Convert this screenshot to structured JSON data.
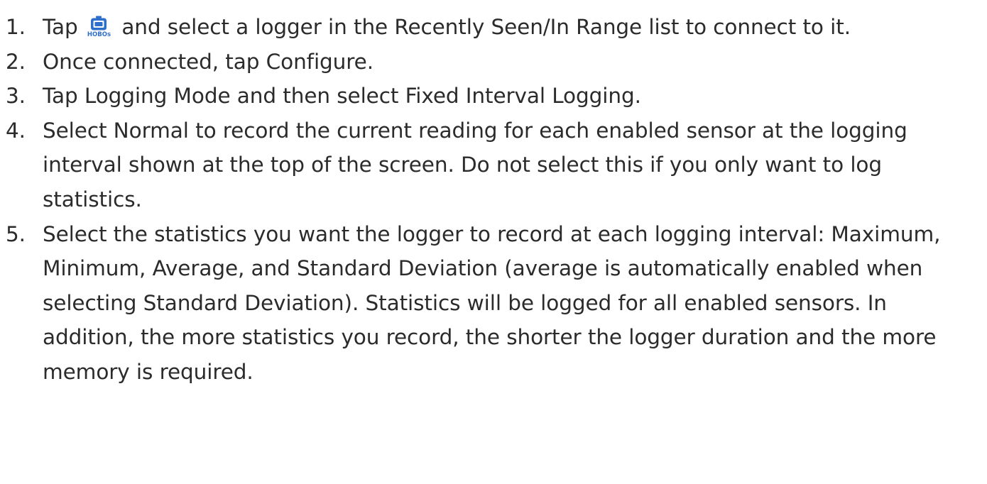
{
  "steps": [
    {
      "number": "1.",
      "before_icon": "Tap",
      "icon": {
        "name": "hobos-logger-icon",
        "label": "HOBOs",
        "color": "#2e6fcc"
      },
      "after_icon": "and select a logger in the Recently Seen/In Range list to connect to it."
    },
    {
      "number": "2.",
      "text": "Once connected, tap Configure."
    },
    {
      "number": "3.",
      "text": "Tap Logging Mode and then select Fixed Interval Logging."
    },
    {
      "number": "4.",
      "text": "Select Normal to record the current reading for each enabled sensor at the logging interval shown at the top of the screen. Do not select this if you only want to log statistics."
    },
    {
      "number": "5.",
      "text": "Select the statistics you want the logger to record at each logging interval: Maximum, Minimum, Average, and Standard Deviation (average is automatically enabled when selecting Standard Deviation). Statistics will be logged for all enabled sensors. In addition, the more statistics you record, the shorter the logger duration and the more memory is required."
    }
  ]
}
